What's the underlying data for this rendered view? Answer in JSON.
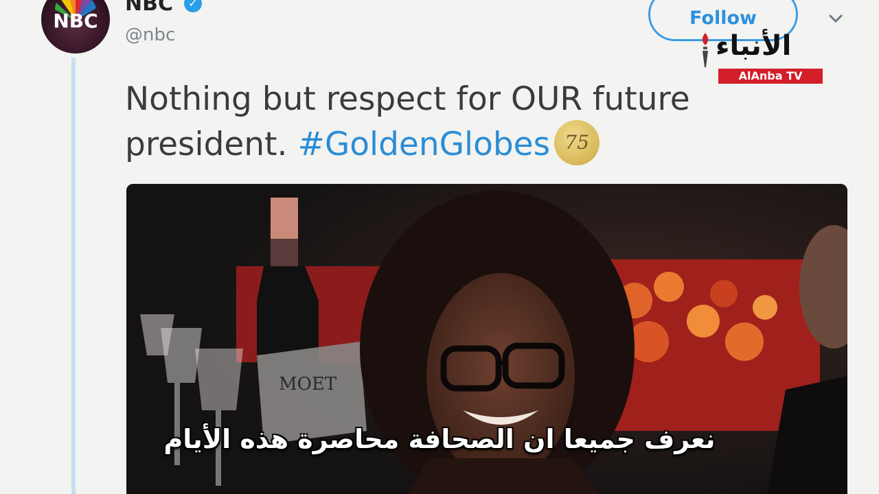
{
  "tweet": {
    "display_name": "NBC",
    "handle": "@nbc",
    "follow_label": "Follow",
    "text_main": "Nothing but respect for OUR future president.",
    "hashtag": "#GoldenGlobes",
    "badge": "75"
  },
  "avatar": {
    "label": "NBC"
  },
  "watermark": {
    "arabic": "الأنباء",
    "latin": "AlAnba TV"
  },
  "subtitle": "نعرف جميعا ان الصحافة محاصرة هذه الأيام",
  "colors": {
    "link_blue": "#2a8dd6",
    "verified_blue": "#2b9ee8",
    "brand_red": "#d31f2a"
  }
}
